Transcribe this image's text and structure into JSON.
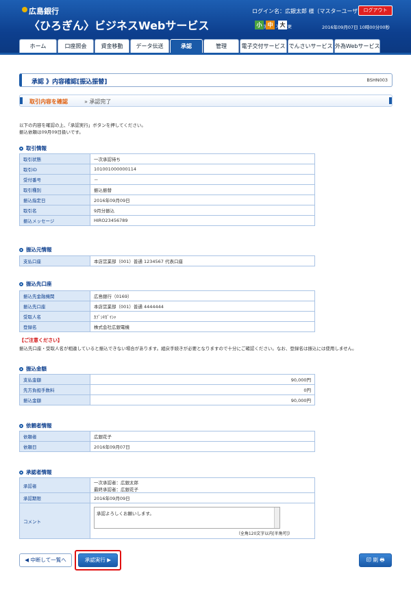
{
  "header": {
    "bank": "広島銀行",
    "service": "〈ひろぎん〉ビジネスWebサービス",
    "login": "ログイン名：広銀太郎 様（マスターユーザ）",
    "logout": "ログアウト",
    "font_size_label": "文字サイズを変更",
    "fs_small": "小",
    "fs_medium": "中",
    "fs_large": "大",
    "datetime": "2016年09月07日 10時00分00秒"
  },
  "nav": [
    "ホーム",
    "口座照会",
    "資金移動",
    "データ伝送",
    "承認",
    "管理",
    "電子交付サービス",
    "でんさいサービス",
    "外為Webサービス"
  ],
  "page": {
    "title": "承認 》内容確認[振込振替]",
    "screen_id": "BSHN003",
    "step1": "取引内容を確認",
    "step2": "» 承認完了",
    "intro1": "以下の内容を確認の上、「承認実行」ボタンを押してください。",
    "intro2": "振込依頼は09月09日扱いです。"
  },
  "sections": {
    "torihiki": {
      "title": "取引情報",
      "rows": [
        [
          "取引状態",
          "一次承認待ち"
        ],
        [
          "取引ID",
          "101001000000114"
        ],
        [
          "受付番号",
          "－"
        ],
        [
          "取引種別",
          "振込振替"
        ],
        [
          "振込指定日",
          "2016年09月09日"
        ],
        [
          "取引名",
          "9月分振込"
        ],
        [
          "振込メッセージ",
          "HIRO23456789"
        ]
      ]
    },
    "moto": {
      "title": "振込元情報",
      "rows": [
        [
          "支払口座",
          "本店営業部（001）普通 1234567 代表口座"
        ]
      ]
    },
    "saki": {
      "title": "振込先口座",
      "rows": [
        [
          "振込先金融機関",
          "広島銀行（0169）"
        ],
        [
          "振込先口座",
          "本店営業部（001）普通 4444444"
        ],
        [
          "受取人名",
          "ｶﾌﾞｼｷｶﾞｲｼｬ"
        ],
        [
          "登録名",
          "株式会社広銀電機"
        ]
      ]
    },
    "kingaku": {
      "title": "振込金額",
      "rows": [
        [
          "支払金額",
          "90,000円"
        ],
        [
          "先方負担手数料",
          "0円"
        ],
        [
          "振込金額",
          "90,000円"
        ]
      ]
    },
    "irai": {
      "title": "依頼者情報",
      "rows": [
        [
          "依頼者",
          "広銀花子"
        ],
        [
          "依頼日",
          "2016年09月07日"
        ]
      ]
    },
    "shonin": {
      "title": "承認者情報",
      "approver_label": "承認者",
      "approver1": "一次承認者：広銀太郎",
      "approver2": "最終承認者：広銀花子",
      "deadline_label": "承認期限",
      "deadline": "2016年09月09日",
      "comment_label": "コメント",
      "comment": "承認よろしくお願いします。",
      "comment_note": "（全角120文字以内[半角可]）"
    }
  },
  "notice": {
    "head": "【ご注意ください】",
    "body": "振込先口座・受取人名が相違していると振込できない場合があります。組戻手続きが必要となりますので十分にご確認ください。なお、登録名は振込には使用しません。"
  },
  "buttons": {
    "back": "◀ 中断して一覧へ",
    "ok": "承認実行 ▶",
    "print": "印 刷 🖶"
  }
}
